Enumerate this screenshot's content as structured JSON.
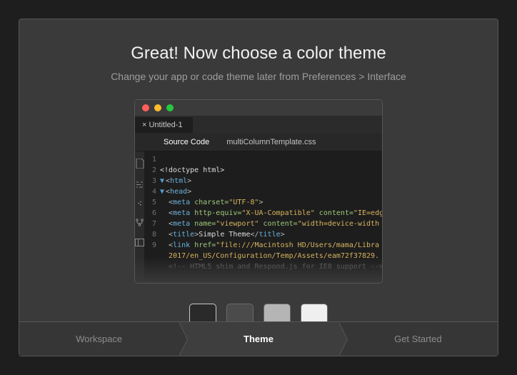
{
  "header": {
    "title": "Great! Now choose a color theme",
    "subtitle": "Change your app or code theme later from Preferences > Interface"
  },
  "editor": {
    "tab_label": "× Untitled-1",
    "subtab_source": "Source Code",
    "subtab_file": "multiColumnTemplate.css",
    "gutter": "1\n2\n3\n4\n5\n6\n7\n8\n9",
    "lines": {
      "l1": "<!doctype html>",
      "l2_fold": "▼",
      "l2_open": "<",
      "l2_tag": "html",
      "l2_close": ">",
      "l3_fold": "▼",
      "l3_open": "<",
      "l3_tag": "head",
      "l3_close": ">",
      "l4_open": "<",
      "l4_tag": "meta",
      "l4_attr": " charset=",
      "l4_str": "\"UTF-8\"",
      "l4_close": ">",
      "l5_open": "<",
      "l5_tag": "meta",
      "l5_attr1": " http-equiv=",
      "l5_str1": "\"X-UA-Compatible\"",
      "l5_attr2": " content=",
      "l5_str2": "\"IE=edg",
      "l6_open": "<",
      "l6_tag": "meta",
      "l6_attr1": " name=",
      "l6_str1": "\"viewport\"",
      "l6_attr2": " content=",
      "l6_str2": "\"width=device-width",
      "l7_open": "<",
      "l7_tag": "title",
      "l7_close": ">",
      "l7_text": "Simple Theme",
      "l7_open2": "</",
      "l7_tag2": "title",
      "l7_close2": ">",
      "l8_open": "<",
      "l8_tag": "link",
      "l8_attr": " href=",
      "l8_str": "\"file:///Macintosh HD/Users/mama/Libra",
      "l9": "2017/en_US/Configuration/Temp/Assets/eam72f37829.",
      "l10": "<!-- HTML5 shim and Respond.js for IE8 support -->"
    }
  },
  "swatches": {
    "c1": "#2a2a2a",
    "c2": "#4b4b4b",
    "c3": "#b5b5b5",
    "c4": "#efefef"
  },
  "steps": {
    "s1": "Workspace",
    "s2": "Theme",
    "s3": "Get Started"
  }
}
